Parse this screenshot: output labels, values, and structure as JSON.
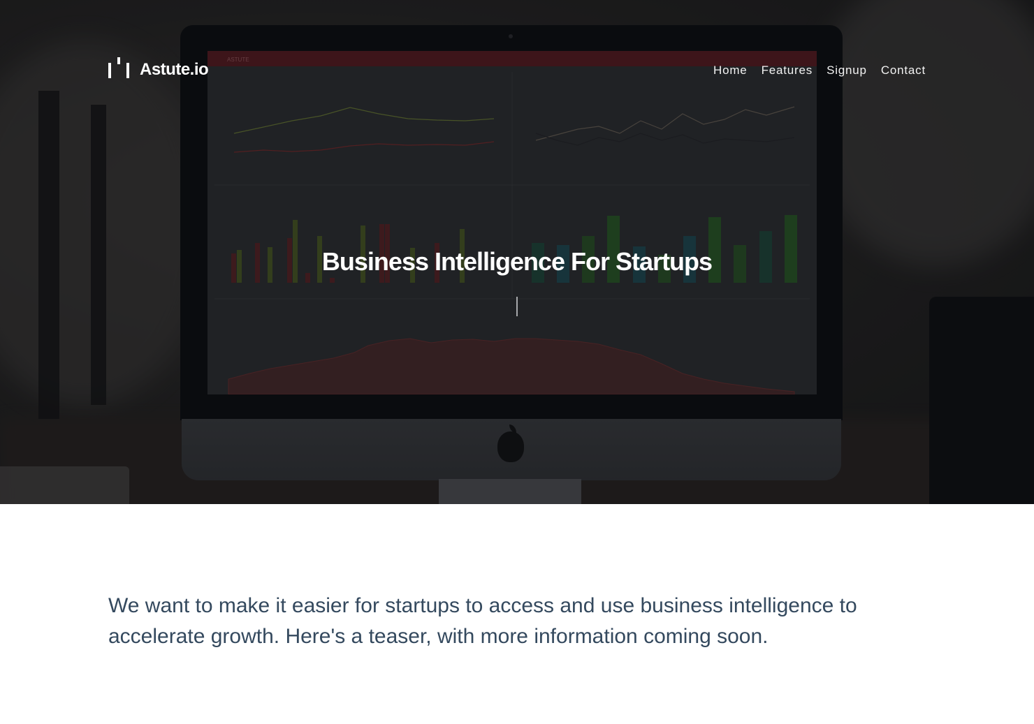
{
  "brand": {
    "name": "Astute.io",
    "logo_icon": "bars-logo-icon"
  },
  "nav": {
    "items": [
      {
        "label": "Home"
      },
      {
        "label": "Features"
      },
      {
        "label": "Signup"
      },
      {
        "label": "Contact"
      }
    ]
  },
  "hero": {
    "title": "Business Intelligence For Startups",
    "screen_app_name": "ASTUTE"
  },
  "intro": {
    "text": "We want to make it easier for startups to access and use business intelligence to accelerate growth. Here's a teaser, with more information coming soon."
  },
  "colors": {
    "nav_text": "#f2f2f2",
    "hero_title": "#ffffff",
    "body_text": "#34495e",
    "screen_topbar": "#5a1b1f"
  }
}
